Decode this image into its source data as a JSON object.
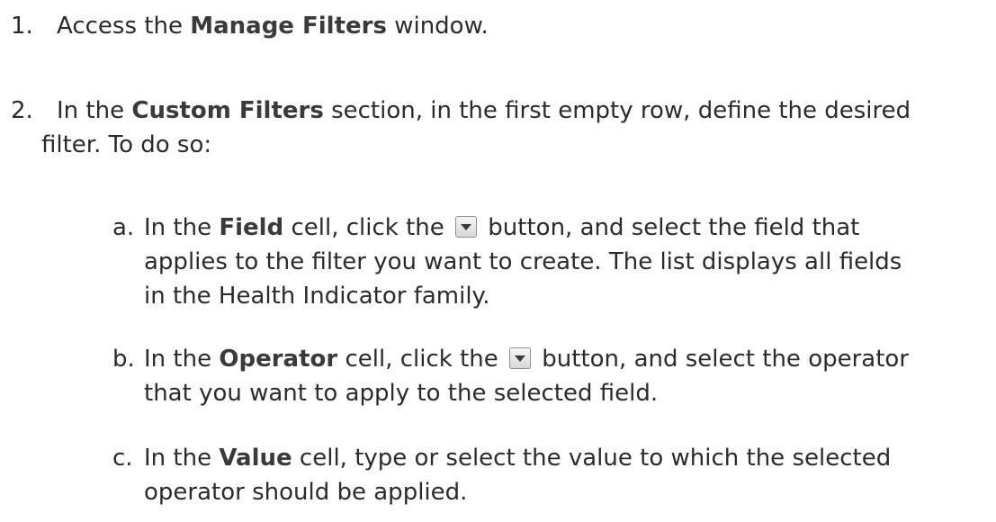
{
  "steps": [
    {
      "number": "1.",
      "pre": "Access the ",
      "bold": "Manage Filters",
      "post": " window."
    },
    {
      "number": "2.",
      "pre": "In the ",
      "bold": "Custom Filters",
      "post": " section, in the first empty row, define the desired",
      "line2": "filter. To do so:"
    }
  ],
  "substeps": [
    {
      "letter": "a.",
      "pre": "In the ",
      "bold": "Field",
      "mid": " cell, click the ",
      "button_icon": "dropdown-arrow-icon",
      "post": " button, and select the field that",
      "line2": "applies to the filter you want to create. The list displays all fields",
      "line3": "in the Health Indicator family."
    },
    {
      "letter": "b.",
      "pre": "In the ",
      "bold": "Operator",
      "mid": " cell, click the ",
      "button_icon": "dropdown-arrow-icon",
      "post": " button, and select the operator",
      "line2": "that you want to apply to the selected field."
    },
    {
      "letter": "c.",
      "pre": "In the ",
      "bold": "Value",
      "post": " cell, type or select the value to which the selected",
      "line2": "operator should be applied."
    }
  ]
}
